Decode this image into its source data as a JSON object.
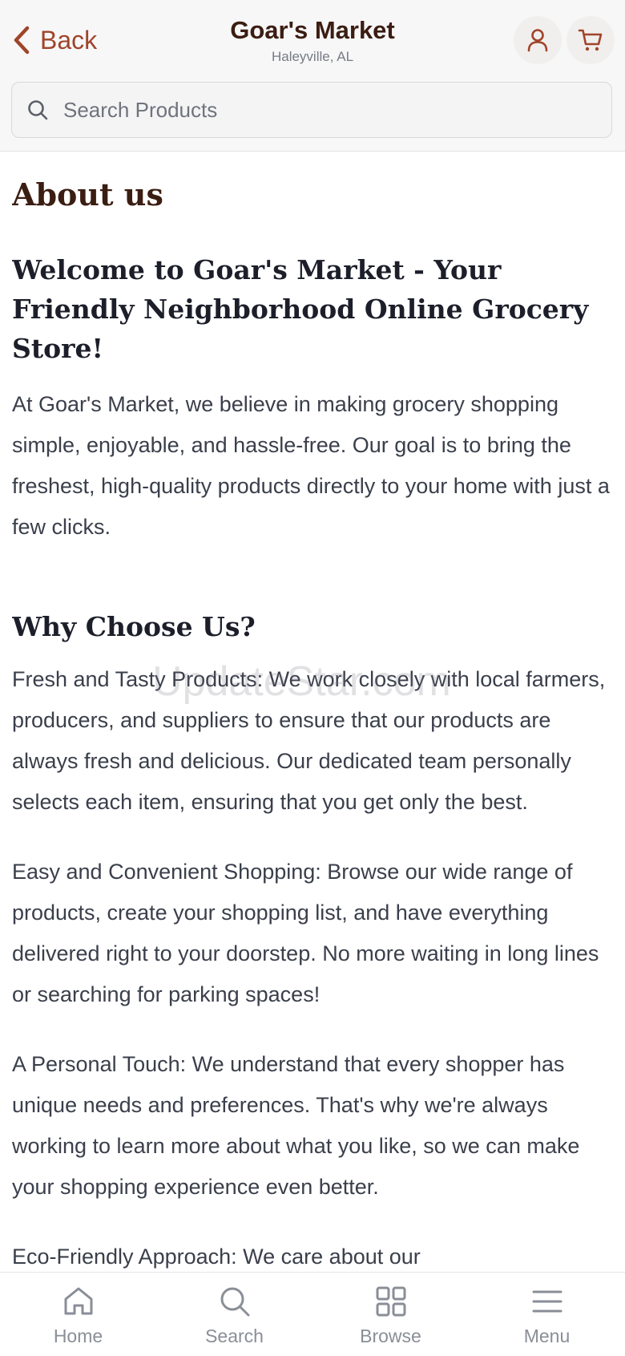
{
  "header": {
    "back_label": "Back",
    "store_name": "Goar's Market",
    "store_location": "Haleyville, AL",
    "search_placeholder": "Search Products"
  },
  "content": {
    "title": "About us",
    "welcome_heading": "Welcome to Goar's Market - Your Friendly Neighborhood Online Grocery Store!",
    "intro": "At Goar's Market, we believe in making grocery shopping simple, enjoyable, and hassle-free. Our goal is to bring the freshest, high-quality products directly to your home with just a few clicks.",
    "why_heading": "Why Choose Us?",
    "fresh": "Fresh and Tasty Products: We work closely with local farmers, producers, and suppliers to ensure that our products are always fresh and delicious. Our dedicated team personally selects each item, ensuring that you get only the best.",
    "easy": "Easy and Convenient Shopping: Browse our wide range of products, create your shopping list, and have everything delivered right to your doorstep. No more waiting in long lines or searching for parking spaces!",
    "personal": "A Personal Touch: We understand that every shopper has unique needs and preferences. That's why we're always working to learn more about what you like, so we can make your shopping experience even better.",
    "eco": "Eco-Friendly Approach: We care about our"
  },
  "watermark": "UpdateStar.com",
  "bottom_nav": {
    "home": "Home",
    "search": "Search",
    "browse": "Browse",
    "menu": "Menu"
  },
  "icons": {
    "back": "chevron-left-icon",
    "account": "user-icon",
    "cart": "cart-icon",
    "search": "search-icon",
    "home": "home-icon",
    "browse": "grid-icon",
    "menu": "hamburger-icon"
  },
  "colors": {
    "accent": "#a0452a",
    "brand_dark": "#3b1d12",
    "nav_inactive": "#8a8e97"
  }
}
